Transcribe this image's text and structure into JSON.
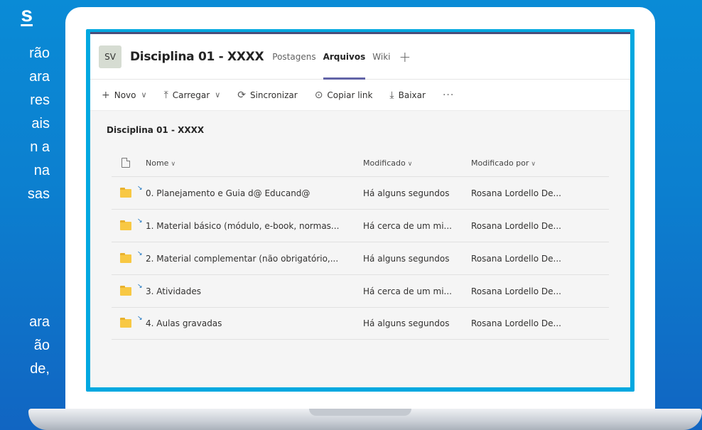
{
  "slide_text": {
    "heading": "s",
    "lines": [
      "rão",
      "ara",
      "res",
      "ais",
      "n a",
      "na",
      "sas",
      "ara",
      "ão",
      "de,"
    ]
  },
  "header": {
    "avatar": "SV",
    "team_title": "Disciplina 01 - XXXX",
    "tabs": [
      {
        "label": "Postagens",
        "active": false
      },
      {
        "label": "Arquivos",
        "active": true
      },
      {
        "label": "Wiki",
        "active": false
      }
    ],
    "add_tab_icon": "+"
  },
  "toolbar": {
    "new_label": "Novo",
    "upload_label": "Carregar",
    "sync_label": "Sincronizar",
    "copy_link_label": "Copiar link",
    "download_label": "Baixar",
    "more_label": "···"
  },
  "breadcrumb": "Disciplina 01 - XXXX",
  "columns": {
    "name": "Nome",
    "modified": "Modificado",
    "modified_by": "Modificado por"
  },
  "files": [
    {
      "name": "0. Planejamento e Guia d@ Educand@",
      "modified": "Há alguns segundos",
      "modified_by": "Rosana Lordello De..."
    },
    {
      "name": "1. Material básico (módulo, e-book, normas...",
      "modified": "Há cerca de um mi...",
      "modified_by": "Rosana Lordello De..."
    },
    {
      "name": "2. Material complementar (não obrigatório,...",
      "modified": "Há alguns segundos",
      "modified_by": "Rosana Lordello De..."
    },
    {
      "name": "3. Atividades",
      "modified": "Há cerca de um mi...",
      "modified_by": "Rosana Lordello De..."
    },
    {
      "name": "4. Aulas gravadas",
      "modified": "Há alguns segundos",
      "modified_by": "Rosana Lordello De..."
    }
  ],
  "colors": {
    "background": "#0a8bd6",
    "screen_border": "#00a8e0",
    "accent": "#6264a7",
    "folder": "#f8c843"
  }
}
